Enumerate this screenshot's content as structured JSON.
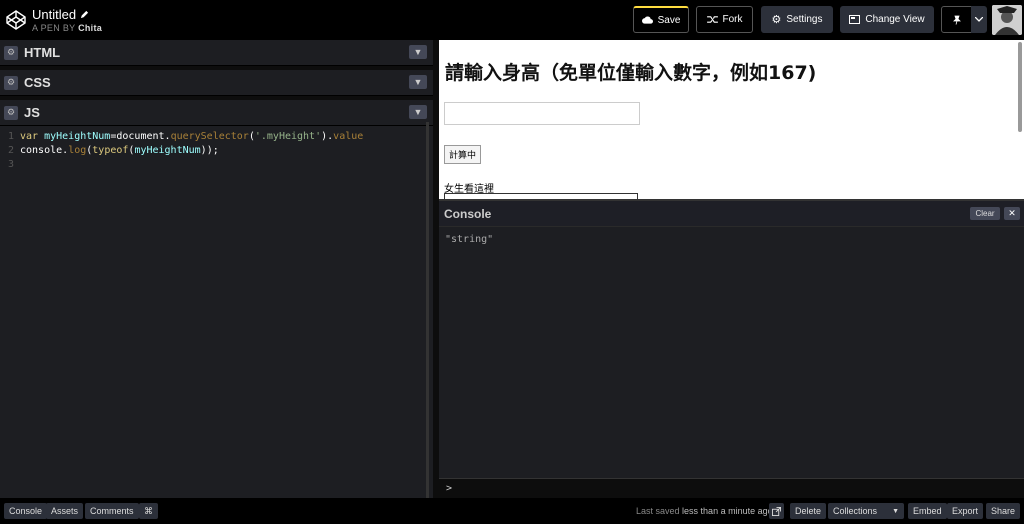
{
  "header": {
    "title": "Untitled",
    "pen_by_prefix": "A PEN BY",
    "author": "Chita",
    "buttons": {
      "save": "Save",
      "fork": "Fork",
      "settings": "Settings",
      "change_view": "Change View"
    }
  },
  "panels": {
    "html": "HTML",
    "css": "CSS",
    "js": "JS"
  },
  "js_code": {
    "line_numbers": [
      "1",
      "2",
      "3"
    ],
    "line1": {
      "kw": "var",
      "name": "myHeightNum",
      "eq": "=",
      "obj": "document",
      "dot1": ".",
      "method": "querySelector",
      "open": "(",
      "arg": "'.myHeight'",
      "close": ")",
      "dot2": ".",
      "prop": "value"
    },
    "line2": {
      "obj": "console",
      "dot": ".",
      "method": "log",
      "open": "(",
      "kw": "typeof",
      "inner_open": "(",
      "name": "myHeightNum",
      "end": "));"
    }
  },
  "preview": {
    "heading": "請輸入身高（免單位僅輸入數字，例如167)",
    "calc_button": "計算中",
    "label": "女生看這裡"
  },
  "console": {
    "title": "Console",
    "clear": "Clear",
    "close": "✕",
    "output": "\"string\"",
    "prompt": ">"
  },
  "footer": {
    "console": "Console",
    "assets": "Assets",
    "comments": "Comments",
    "shortcut": "⌘",
    "saved_prefix": "Last saved",
    "saved_time": "less than a minute ago",
    "delete": "Delete",
    "collections": "Collections",
    "embed": "Embed",
    "export": "Export",
    "share": "Share"
  },
  "colors": {
    "accent": "#ffdd40",
    "topbar": "#000000",
    "button": "#2c303a"
  }
}
